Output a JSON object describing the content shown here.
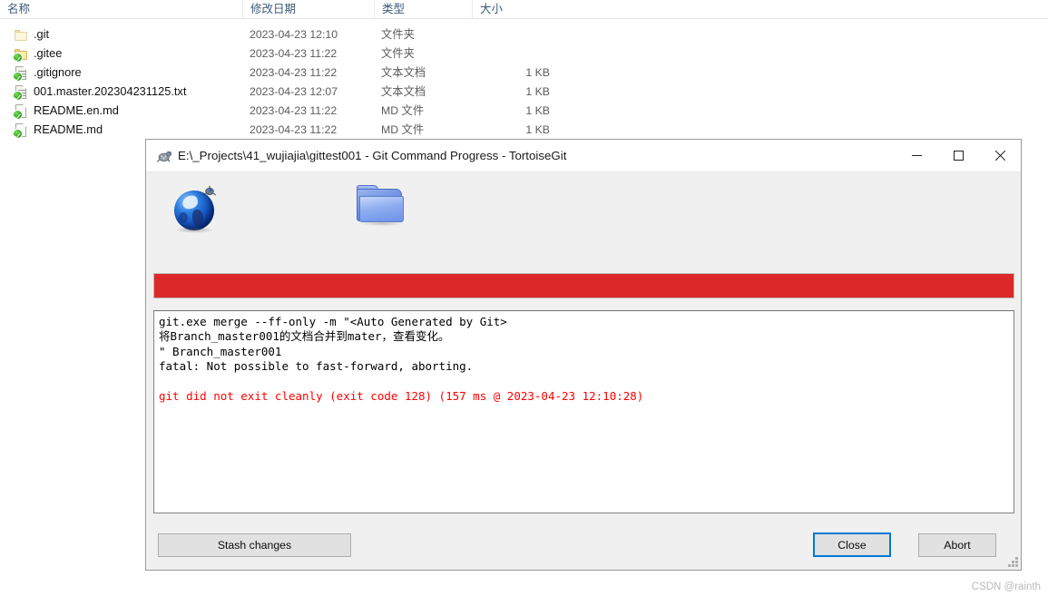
{
  "explorer": {
    "columns": [
      {
        "label": "名称",
        "key": "name"
      },
      {
        "label": "修改日期",
        "key": "date"
      },
      {
        "label": "类型",
        "key": "type"
      },
      {
        "label": "大小",
        "key": "size"
      }
    ],
    "rows": [
      {
        "name": ".git",
        "date": "2023-04-23 12:10",
        "type": "文件夹",
        "size": "",
        "icon": "folder-plain-icon",
        "overlay": "none"
      },
      {
        "name": ".gitee",
        "date": "2023-04-23 11:22",
        "type": "文件夹",
        "size": "",
        "icon": "folder-icon",
        "overlay": "green-check-icon"
      },
      {
        "name": ".gitignore",
        "date": "2023-04-23 11:22",
        "type": "文本文档",
        "size": "1 KB",
        "icon": "text-file-icon",
        "overlay": "green-check-icon"
      },
      {
        "name": "001.master.202304231125.txt",
        "date": "2023-04-23 12:07",
        "type": "文本文档",
        "size": "1 KB",
        "icon": "text-file-icon",
        "overlay": "green-check-icon"
      },
      {
        "name": "README.en.md",
        "date": "2023-04-23 11:22",
        "type": "MD 文件",
        "size": "1 KB",
        "icon": "md-file-icon",
        "overlay": "green-check-icon"
      },
      {
        "name": "README.md",
        "date": "2023-04-23 11:22",
        "type": "MD 文件",
        "size": "1 KB",
        "icon": "md-file-icon",
        "overlay": "green-check-icon"
      }
    ]
  },
  "dialog": {
    "title": "E:\\_Projects\\41_wujiajia\\gittest001 - Git Command Progress - TortoiseGit",
    "title_icon": "tortoisegit-turtle-icon",
    "window_controls": {
      "minimize": "minimize-icon",
      "maximize": "maximize-icon",
      "close": "close-icon"
    },
    "animation_icons": {
      "left": "globe-satellite-icon",
      "right": "blue-folder-icon"
    },
    "progress": {
      "percent": 100,
      "state": "error",
      "color": "#dc2828",
      "track_color": "#ffffff"
    },
    "log": {
      "lines": [
        {
          "text": "git.exe merge --ff-only -m \"<Auto Generated by Git>",
          "color": "black"
        },
        {
          "text": "将Branch_master001的文档合并到mater，查看变化。",
          "color": "black"
        },
        {
          "text": "\" Branch_master001",
          "color": "black"
        },
        {
          "text": "fatal: Not possible to fast-forward, aborting.",
          "color": "black"
        },
        {
          "text": "",
          "color": "black"
        },
        {
          "text": "git did not exit cleanly (exit code 128) (157 ms @ 2023-04-23 12:10:28)",
          "color": "red"
        }
      ],
      "error_color": "#ff0000"
    },
    "buttons": {
      "stash": "Stash changes",
      "close": "Close",
      "abort": "Abort",
      "focus_color": "#0078d7"
    },
    "resize_grip": "resize-grip-icon"
  },
  "watermark": "CSDN @rainth"
}
